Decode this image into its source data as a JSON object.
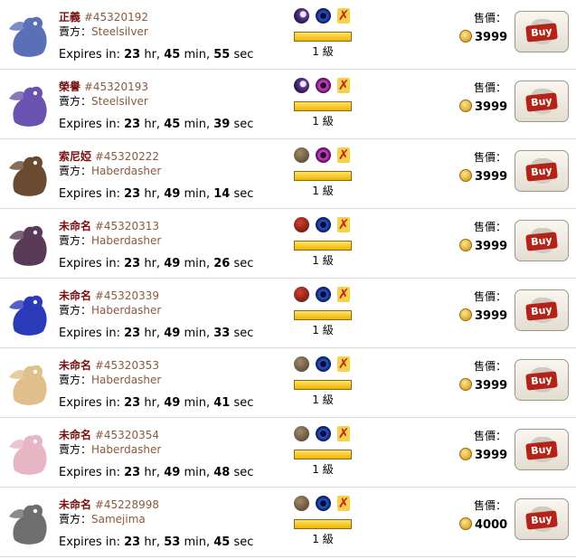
{
  "labels": {
    "seller_prefix": "賣方：",
    "expires_prefix": "Expires in:",
    "price_label": "售價：",
    "level_suffix": "級",
    "buy": "Buy"
  },
  "listings": [
    {
      "name": "正義",
      "id": "#45320192",
      "seller": "Steelsilver",
      "hr": "23",
      "hr_u": "hr,",
      "min": "45",
      "min_u": "min,",
      "sec": "55",
      "sec_u": "sec",
      "level": "1",
      "price": "3999",
      "gene1": "purple-moon-gene-icon",
      "gene2": "blue-eye-gene-icon",
      "dragon_color": "#5b6fb8"
    },
    {
      "name": "榮譽",
      "id": "#45320193",
      "seller": "Steelsilver",
      "hr": "23",
      "hr_u": "hr,",
      "min": "45",
      "min_u": "min,",
      "sec": "39",
      "sec_u": "sec",
      "level": "1",
      "price": "3999",
      "gene1": "purple-moon-gene-icon",
      "gene2": "pink-eye-gene-icon",
      "dragon_color": "#6a52b0"
    },
    {
      "name": "索尼婭",
      "id": "#45320222",
      "seller": "Haberdasher",
      "hr": "23",
      "hr_u": "hr,",
      "min": "49",
      "min_u": "min,",
      "sec": "14",
      "sec_u": "sec",
      "level": "1",
      "price": "3999",
      "gene1": "brown-rock-gene-icon",
      "gene2": "pink-eye-gene-icon",
      "dragon_color": "#6b4a32"
    },
    {
      "name": "未命名",
      "id": "#45320313",
      "seller": "Haberdasher",
      "hr": "23",
      "hr_u": "hr,",
      "min": "49",
      "min_u": "min,",
      "sec": "26",
      "sec_u": "sec",
      "level": "1",
      "price": "3999",
      "gene1": "red-rock-gene-icon",
      "gene2": "blue-eye-gene-icon",
      "dragon_color": "#5a3a58"
    },
    {
      "name": "未命名",
      "id": "#45320339",
      "seller": "Haberdasher",
      "hr": "23",
      "hr_u": "hr,",
      "min": "49",
      "min_u": "min,",
      "sec": "33",
      "sec_u": "sec",
      "level": "1",
      "price": "3999",
      "gene1": "red-rock-gene-icon",
      "gene2": "blue-eye-gene-icon",
      "dragon_color": "#2a3ab8"
    },
    {
      "name": "未命名",
      "id": "#45320353",
      "seller": "Haberdasher",
      "hr": "23",
      "hr_u": "hr,",
      "min": "49",
      "min_u": "min,",
      "sec": "41",
      "sec_u": "sec",
      "level": "1",
      "price": "3999",
      "gene1": "brown-rock-gene-icon",
      "gene2": "blue-eye-gene-icon",
      "dragon_color": "#e0c08a"
    },
    {
      "name": "未命名",
      "id": "#45320354",
      "seller": "Haberdasher",
      "hr": "23",
      "hr_u": "hr,",
      "min": "49",
      "min_u": "min,",
      "sec": "48",
      "sec_u": "sec",
      "level": "1",
      "price": "3999",
      "gene1": "brown-rock-gene-icon",
      "gene2": "blue-eye-gene-icon",
      "dragon_color": "#e7b6c4"
    },
    {
      "name": "未命名",
      "id": "#45228998",
      "seller": "Samejima",
      "hr": "23",
      "hr_u": "hr,",
      "min": "53",
      "min_u": "min,",
      "sec": "45",
      "sec_u": "sec",
      "level": "1",
      "price": "4000",
      "gene1": "brown-rock-gene-icon",
      "gene2": "blue-eye-gene-icon",
      "dragon_color": "#6e6e6e"
    }
  ],
  "colors": {
    "name": "#7a1010",
    "id_and_seller": "#8a5a3c",
    "buy_tag": "#b32318",
    "xp_bar": "#f0b400"
  }
}
